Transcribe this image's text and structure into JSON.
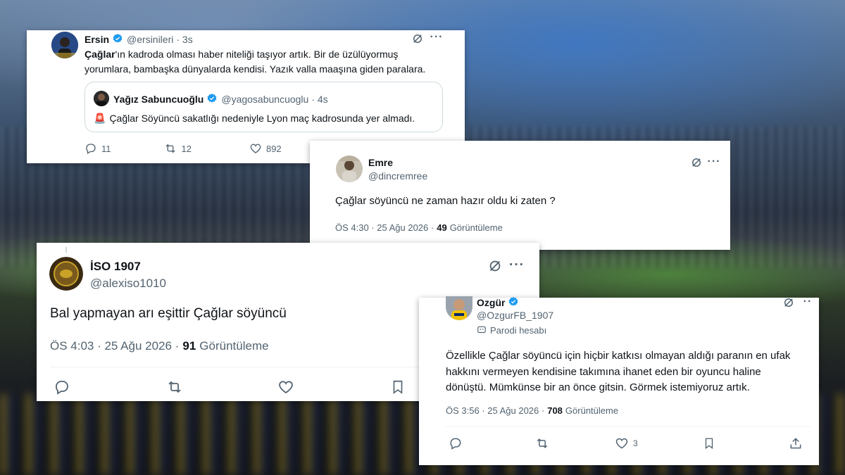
{
  "tweet_ersin": {
    "display_name": "Ersin",
    "handle": "@ersinileri",
    "time": "· 3s",
    "text_bold": "Çağlar",
    "text_rest_line1": "'ın kadroda olması haber niteliği taşıyor artık. Bir de üzülüyormuş",
    "text_line2": "yorumlara, bambaşka dünyalarda kendisi. Yazık valla maaşına giden paralara.",
    "quote": {
      "display_name": "Yağız Sabuncuoğlu",
      "handle": "@yagosabuncuoglu",
      "time": "· 4s",
      "emoji": "🚨",
      "text": "Çağlar Söyüncü sakatlığı nedeniyle Lyon maç kadrosunda yer almadı."
    },
    "replies": "11",
    "retweets": "12",
    "likes": "892"
  },
  "tweet_emre": {
    "display_name": "Emre",
    "handle": "@dincremree",
    "text": "Çağlar söyüncü ne zaman hazır oldu ki zaten ?",
    "time": "ÖS 4:30 · 25 Ağu 2026 ·",
    "views_count": "49",
    "views_label": "Görüntüleme"
  },
  "tweet_iso": {
    "display_name": "İSO 1907",
    "handle": "@alexiso1010",
    "text": "Bal yapmayan arı eşittir Çağlar söyüncü",
    "time": "ÖS 4:03 · 25 Ağu 2026 ·",
    "views_count": "91",
    "views_label": "Görüntüleme"
  },
  "tweet_ozgur": {
    "display_name": "Ozgür",
    "handle": "@OzgurFB_1907",
    "parody_label": "Parodi hesabı",
    "text_line1": "Özellikle Çağlar söyüncü için hiçbir katkısı olmayan aldığı paranın en ufak",
    "text_line2": "hakkını vermeyen kendisine takımına ihanet eden bir oyuncu haline",
    "text_line3": "dönüştü. Mümkünse bir an önce gitsin. Görmek istemiyoruz artık.",
    "time": "ÖS 3:56 · 25 Ağu 2026 ·",
    "views_count": "708",
    "views_label": "Görüntüleme",
    "likes": "3"
  },
  "icons": {
    "grok": "grok-icon",
    "more": "more-icon",
    "reply": "reply-icon",
    "retweet": "retweet-icon",
    "like": "like-icon",
    "bookmark": "bookmark-icon",
    "share": "share-icon",
    "verified": "verified-badge-icon"
  },
  "colors": {
    "verified_blue": "#1d9bf0",
    "text": "#0f1419",
    "muted": "#536471"
  }
}
